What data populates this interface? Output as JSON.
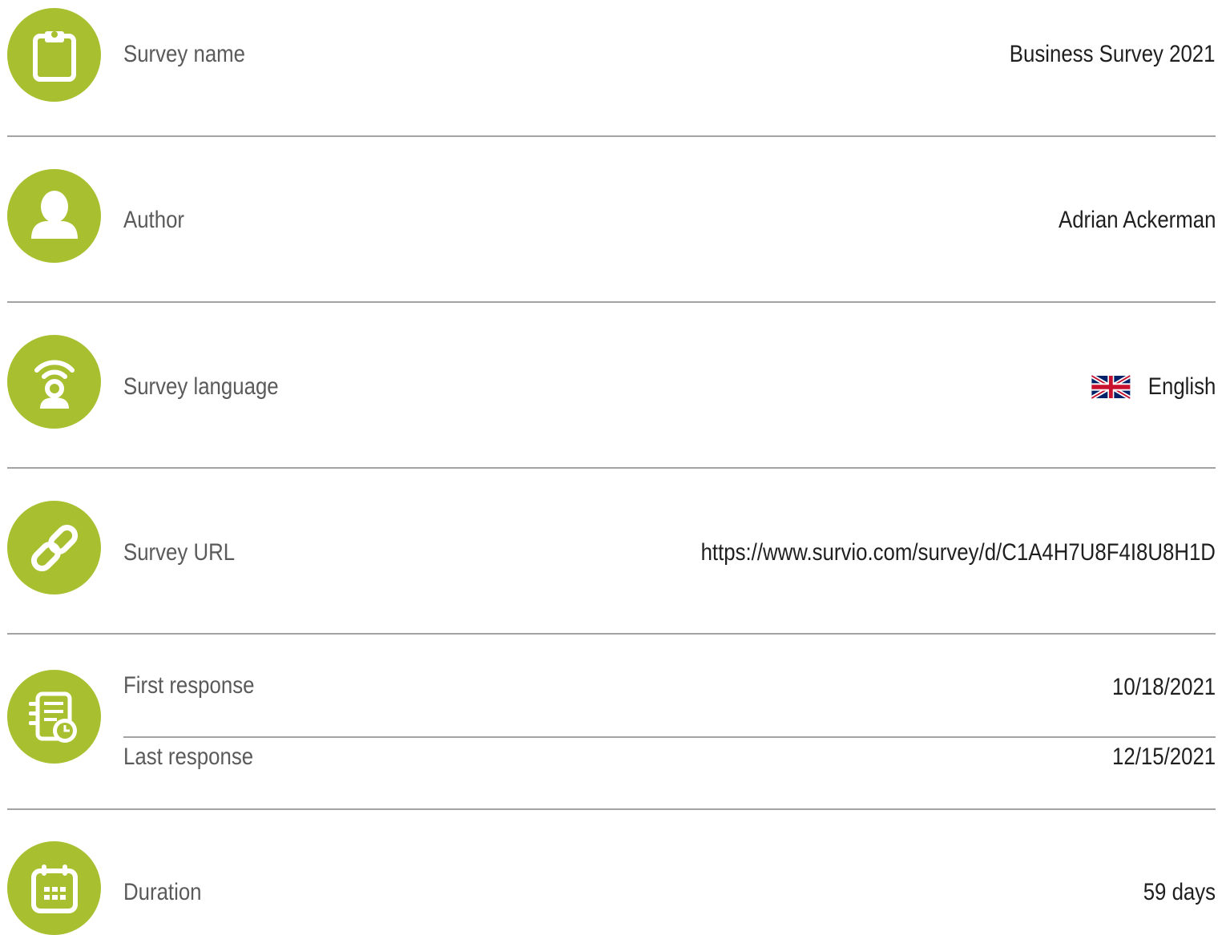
{
  "rows": {
    "survey_name": {
      "label": "Survey name",
      "value": "Business Survey 2021",
      "icon": "clipboard-icon"
    },
    "author": {
      "label": "Author",
      "value": "Adrian Ackerman",
      "icon": "user-icon"
    },
    "survey_language": {
      "label": "Survey language",
      "value": "English",
      "icon": "broadcast-user-icon",
      "flag": "uk-flag-icon"
    },
    "survey_url": {
      "label": "Survey URL",
      "value": "https://www.survio.com/survey/d/C1A4H7U8F4I8U8H1D",
      "icon": "link-icon"
    },
    "first_response": {
      "label": "First response",
      "value": "10/18/2021",
      "icon": "responses-clock-icon"
    },
    "last_response": {
      "label": "Last response",
      "value": "12/15/2021"
    },
    "duration": {
      "label": "Duration",
      "value": "59 days",
      "icon": "calendar-icon"
    }
  },
  "colors": {
    "accent": "#a8c030",
    "divider": "#a3a3a3",
    "label_text": "#5a5a5a",
    "value_text": "#1f1f1f"
  }
}
